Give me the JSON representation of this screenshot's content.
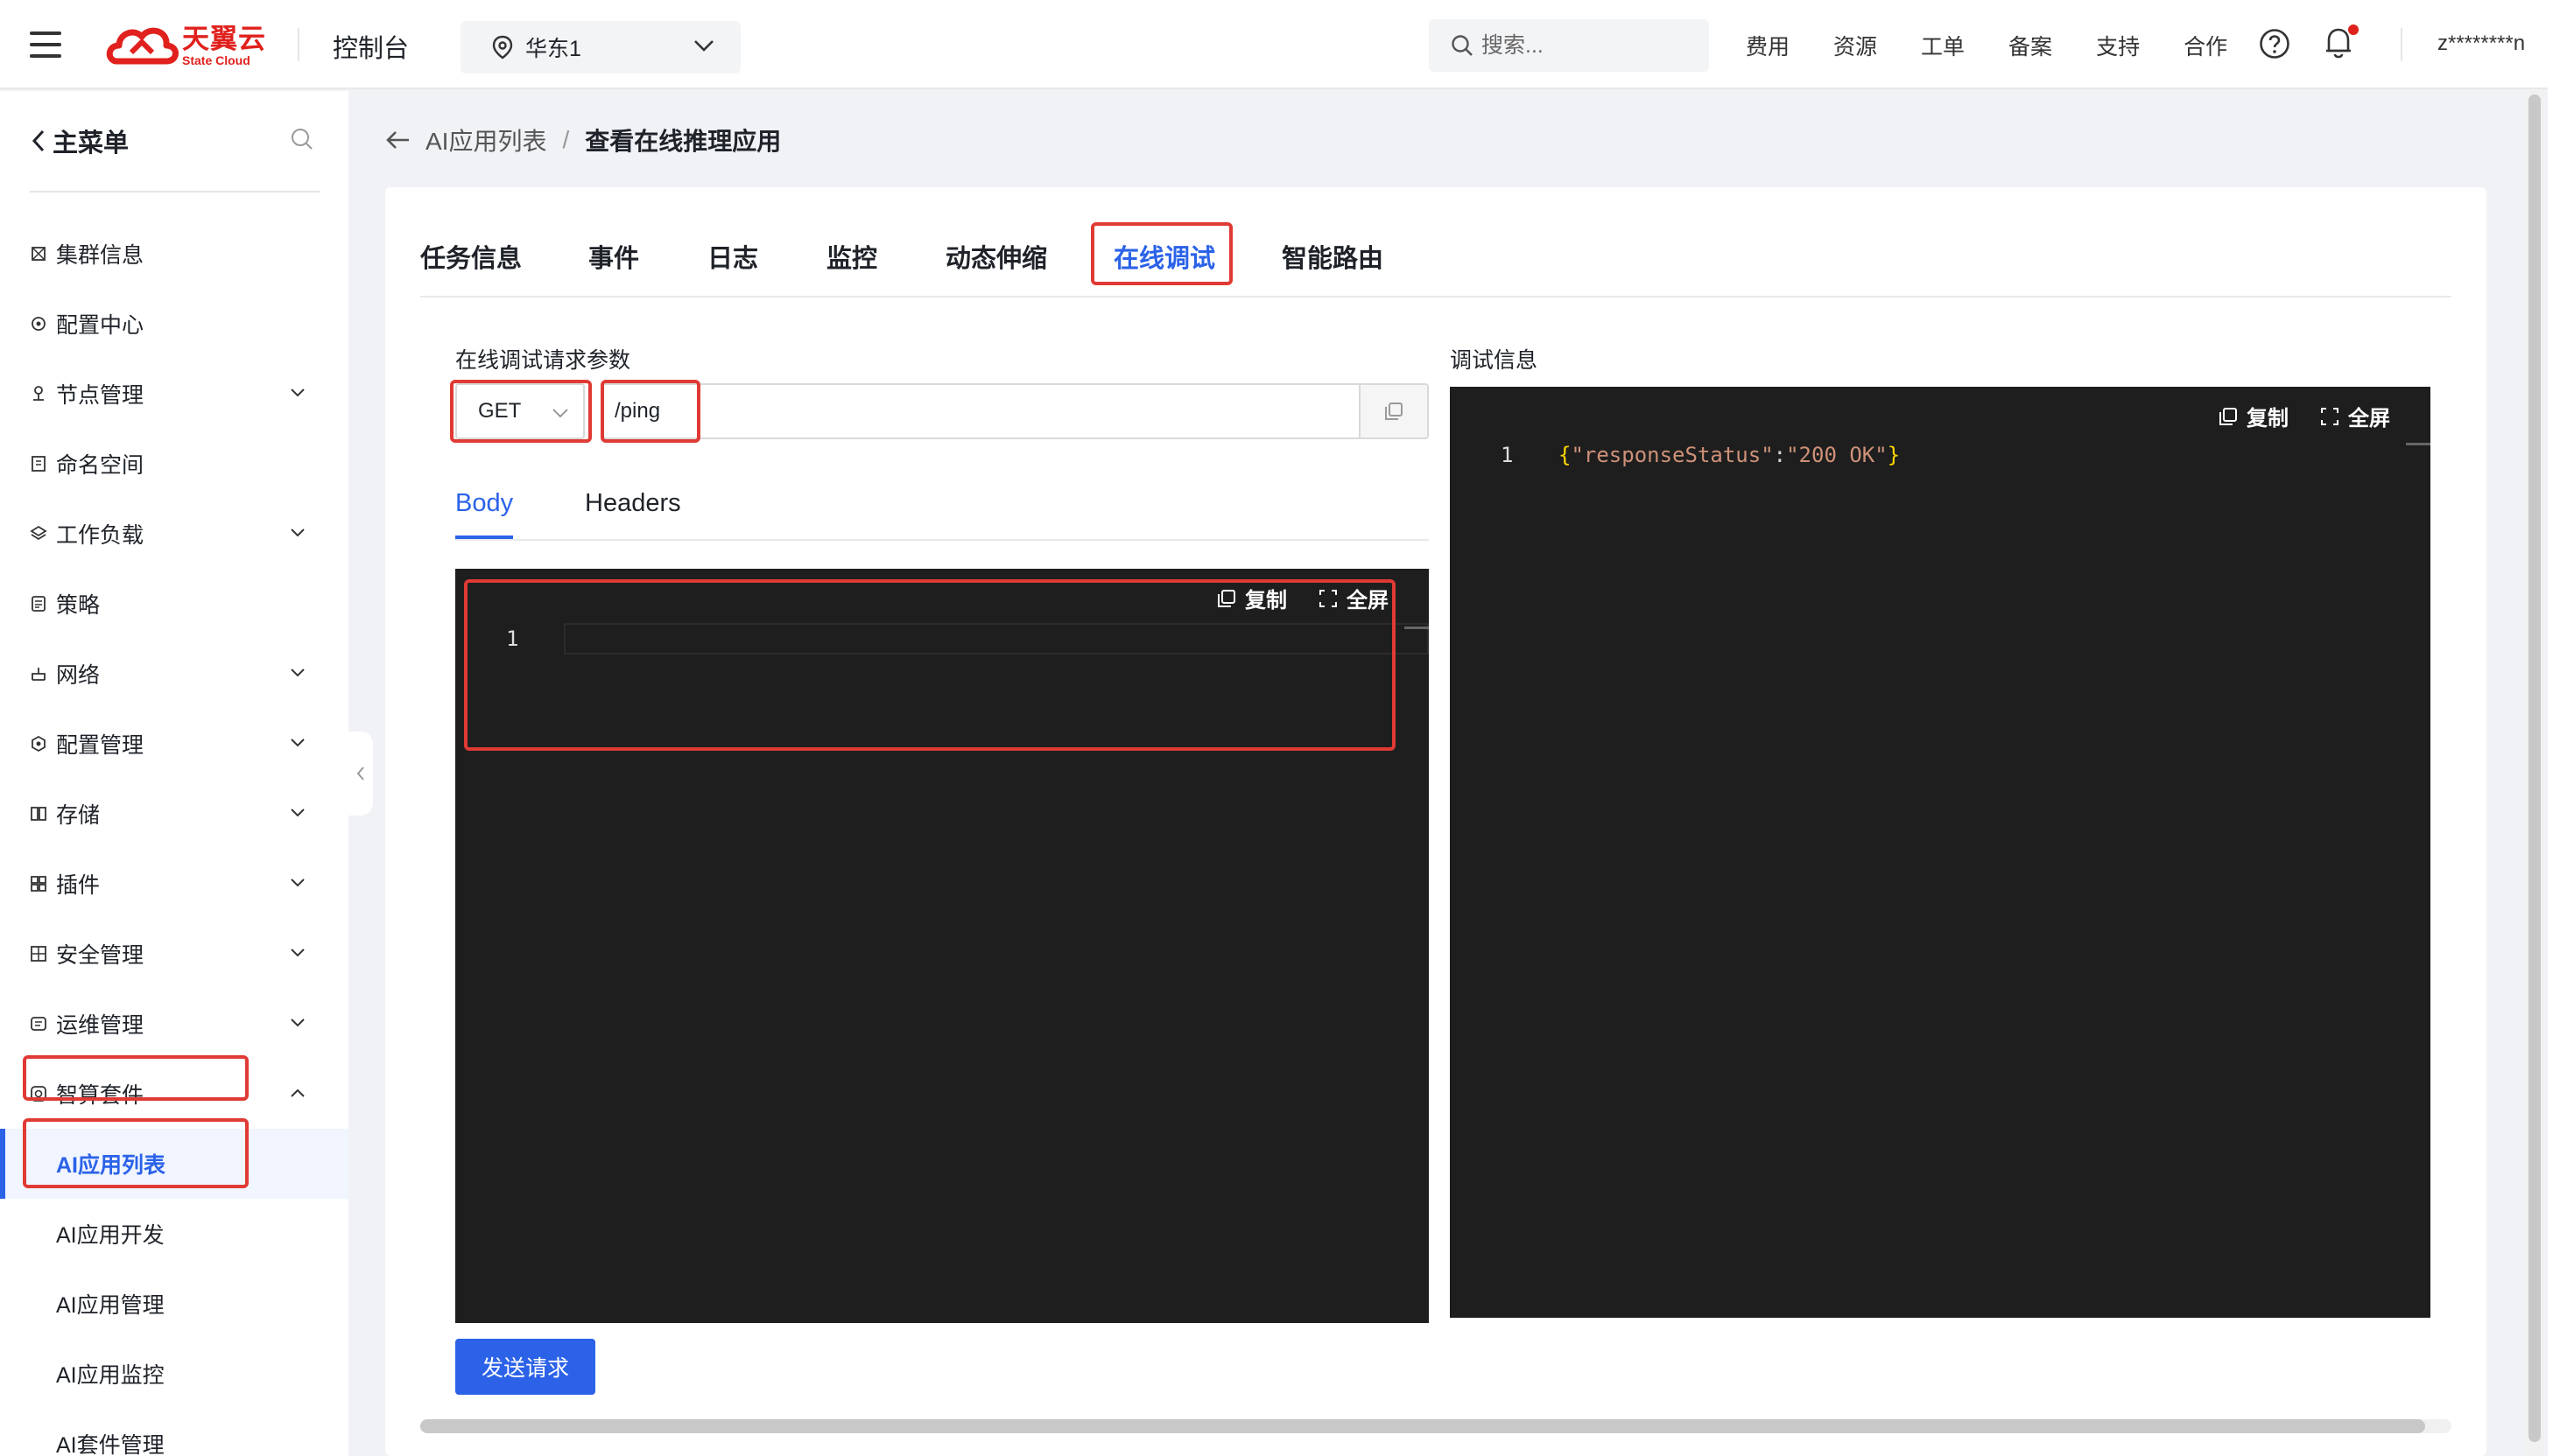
{
  "header": {
    "logo_cn": "天翼云",
    "logo_en": "State Cloud",
    "console_title": "控制台",
    "region": "华东1",
    "search_placeholder": "搜索...",
    "nav": [
      "费用",
      "资源",
      "工单",
      "备案",
      "支持",
      "合作"
    ],
    "user": "z********n"
  },
  "sidebar": {
    "title": "主菜单",
    "items": [
      {
        "label": "集群信息",
        "icon": "cluster-icon",
        "expandable": false
      },
      {
        "label": "配置中心",
        "icon": "config-center-icon",
        "expandable": false
      },
      {
        "label": "节点管理",
        "icon": "node-icon",
        "expandable": true
      },
      {
        "label": "命名空间",
        "icon": "namespace-icon",
        "expandable": false
      },
      {
        "label": "工作负载",
        "icon": "workload-icon",
        "expandable": true
      },
      {
        "label": "策略",
        "icon": "policy-icon",
        "expandable": false
      },
      {
        "label": "网络",
        "icon": "network-icon",
        "expandable": true
      },
      {
        "label": "配置管理",
        "icon": "config-icon",
        "expandable": true
      },
      {
        "label": "存储",
        "icon": "storage-icon",
        "expandable": true
      },
      {
        "label": "插件",
        "icon": "plugin-icon",
        "expandable": true
      },
      {
        "label": "安全管理",
        "icon": "security-icon",
        "expandable": true
      },
      {
        "label": "运维管理",
        "icon": "ops-icon",
        "expandable": true
      },
      {
        "label": "智算套件",
        "icon": "ai-suite-icon",
        "expandable": true,
        "expanded": true
      }
    ],
    "sub_items": [
      "AI应用列表",
      "AI应用开发",
      "AI应用管理",
      "AI应用监控",
      "AI套件管理"
    ],
    "active_sub": "AI应用列表"
  },
  "breadcrumb": {
    "parent": "AI应用列表",
    "separator": "/",
    "current": "查看在线推理应用"
  },
  "tabs": [
    "任务信息",
    "事件",
    "日志",
    "监控",
    "动态伸缩",
    "在线调试",
    "智能路由"
  ],
  "active_tab": "在线调试",
  "request": {
    "label": "在线调试请求参数",
    "method": "GET",
    "path": "/ping",
    "subtabs": [
      "Body",
      "Headers"
    ],
    "active_subtab": "Body",
    "editor_line": "1",
    "copy_label": "复制",
    "fullscreen_label": "全屏",
    "send_label": "发送请求"
  },
  "debug": {
    "label": "调试信息",
    "line": "1",
    "response_open": "{",
    "response_key": "\"responseStatus\"",
    "response_colon": ":",
    "response_value": "\"200 OK\"",
    "response_close": "}",
    "copy_label": "复制",
    "fullscreen_label": "全屏"
  },
  "colors": {
    "accent": "#2b62e8",
    "highlight_box": "#e03a34",
    "brand": "#e0211d",
    "editor_bg": "#1e1e1e",
    "json_string": "#ce9178",
    "json_brace": "#ffd700"
  }
}
